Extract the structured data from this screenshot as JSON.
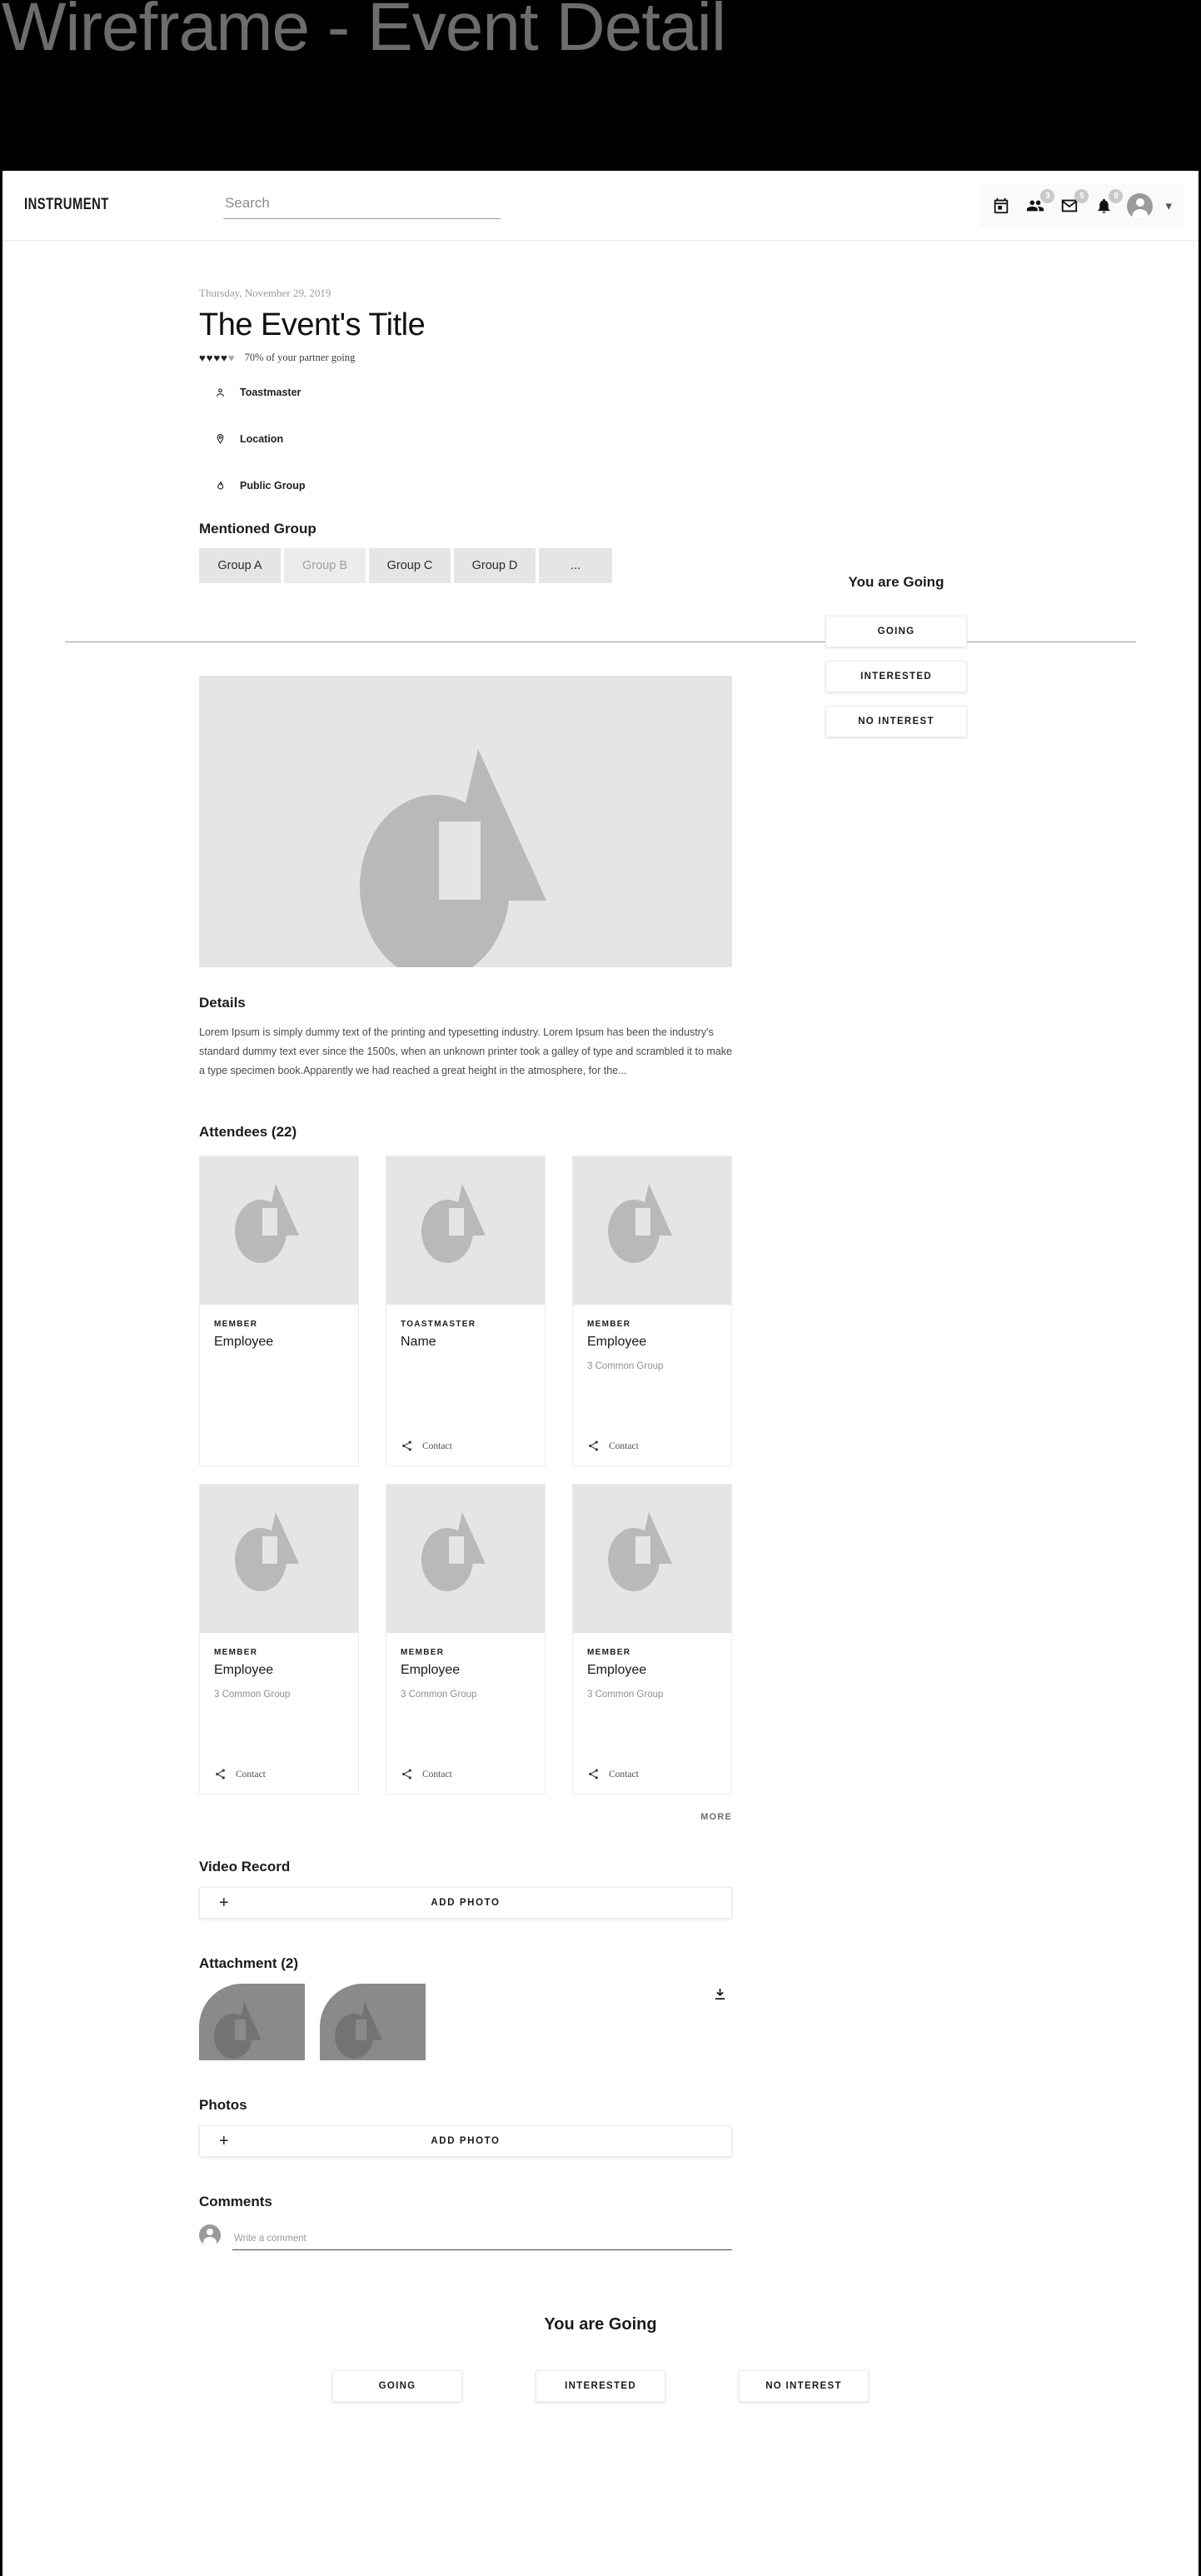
{
  "banner": {
    "title": "Wireframe - Event Detail"
  },
  "nav": {
    "logo": "INSTRUMENT",
    "search_placeholder": "Search",
    "search_value": "",
    "icons": [
      {
        "name": "calendar-icon",
        "badge": ""
      },
      {
        "name": "people-icon",
        "badge": "3"
      },
      {
        "name": "mail-icon",
        "badge": "5"
      },
      {
        "name": "bell-icon",
        "badge": "9"
      }
    ],
    "avatar": "account-avatar",
    "chevron": "⌄"
  },
  "event": {
    "date": "Thursday, November 29, 2019",
    "title": "The Event's Title",
    "rating_filled": 4,
    "rating_total": 5,
    "rating_text": "70% of your partner going",
    "meta": [
      {
        "icon": "person-icon",
        "label": "Toastmaster"
      },
      {
        "icon": "location-pin-icon",
        "label": "Location"
      },
      {
        "icon": "flame-icon",
        "label": "Public Group"
      }
    ],
    "mentioned_group_title": "Mentioned Group",
    "groups": [
      {
        "label": "Group A",
        "dim": false
      },
      {
        "label": "Group B",
        "dim": true
      },
      {
        "label": "Group C",
        "dim": false
      },
      {
        "label": "Group D",
        "dim": false
      },
      {
        "label": "...",
        "dim": false
      }
    ]
  },
  "rsvp": {
    "title": "You are Going",
    "buttons": [
      "GOING",
      "INTERESTED",
      "NO INTEREST"
    ]
  },
  "details": {
    "title": "Details",
    "text": "Lorem Ipsum is simply dummy text of the printing and typesetting industry. Lorem Ipsum has been the industry's standard dummy text ever since the 1500s, when an unknown printer took a galley of type and scrambled it to make a type specimen book.Apparently we had reached a great height in the atmosphere, for the..."
  },
  "attendees": {
    "title": "Attendees (22)",
    "more_label": "MORE",
    "contact_label": "Contact",
    "cards": [
      {
        "role": "MEMBER",
        "name": "Employee",
        "common": "",
        "has_contact": false
      },
      {
        "role": "TOASTMASTER",
        "name": "Name",
        "common": "",
        "has_contact": true
      },
      {
        "role": "MEMBER",
        "name": "Employee",
        "common": "3 Common Group",
        "has_contact": true
      },
      {
        "role": "MEMBER",
        "name": "Employee",
        "common": "3 Common Group",
        "has_contact": true
      },
      {
        "role": "MEMBER",
        "name": "Employee",
        "common": "3 Common Group",
        "has_contact": true
      },
      {
        "role": "MEMBER",
        "name": "Employee",
        "common": "3 Common Group",
        "has_contact": true
      }
    ]
  },
  "video_record": {
    "title": "Video Record",
    "add_label": "ADD PHOTO",
    "plus": "+"
  },
  "attachment": {
    "title": "Attachment (2)",
    "count": 2,
    "download_icon": "download-icon"
  },
  "photos": {
    "title": "Photos",
    "add_label": "ADD PHOTO",
    "plus": "+"
  },
  "comments": {
    "title": "Comments",
    "placeholder": "Write a comment",
    "value": ""
  },
  "footer_rsvp": {
    "title": "You are Going",
    "buttons": [
      "GOING",
      "INTERESTED",
      "NO INTEREST"
    ]
  },
  "colors": {
    "banner_bg": "#000000",
    "banner_text": "#6c6c6c",
    "placeholder_bg": "#e5e5e5",
    "placeholder_shape": "#b9b9b9",
    "attachment_bg": "#8a8a8a",
    "chip_bg": "#e5e5e5"
  }
}
